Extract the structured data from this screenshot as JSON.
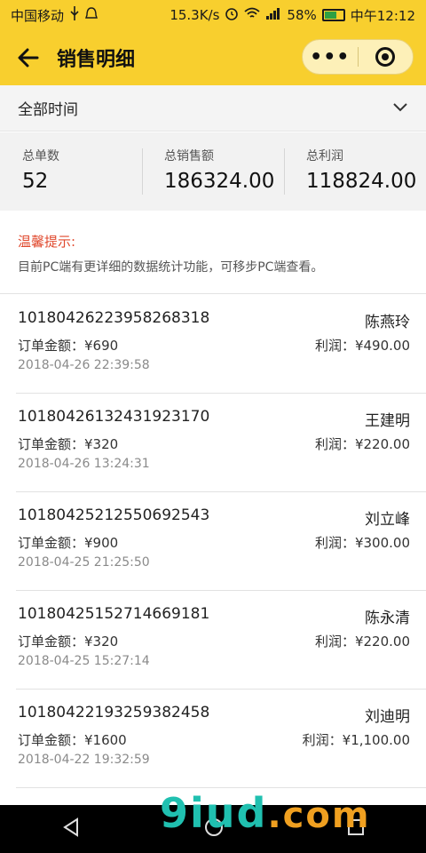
{
  "status_bar": {
    "carrier": "中国移动",
    "speed": "15.3K/s",
    "battery": "58%",
    "time": "中午12:12"
  },
  "header": {
    "title": "销售明细",
    "more_label": "•••"
  },
  "filter": {
    "selected": "全部时间"
  },
  "stats": {
    "orders_label": "总单数",
    "orders_value": "52",
    "sales_label": "总销售额",
    "sales_value": "186324.00",
    "profit_label": "总利润",
    "profit_value": "118824.00"
  },
  "notice": {
    "title": "温馨提示:",
    "text": "目前PC端有更详细的数据统计功能，可移步PC端查看。"
  },
  "orders": [
    {
      "no": "10180426223958268318",
      "name": "陈燕玲",
      "amount": "订单金额：¥690",
      "profit": "利润：¥490.00",
      "time": "2018-04-26 22:39:58"
    },
    {
      "no": "10180426132431923170",
      "name": "王建明",
      "amount": "订单金额：¥320",
      "profit": "利润：¥220.00",
      "time": "2018-04-26 13:24:31"
    },
    {
      "no": "10180425212550692543",
      "name": "刘立峰",
      "amount": "订单金额：¥900",
      "profit": "利润：¥300.00",
      "time": "2018-04-25 21:25:50"
    },
    {
      "no": "10180425152714669181",
      "name": "陈永清",
      "amount": "订单金额：¥320",
      "profit": "利润：¥220.00",
      "time": "2018-04-25 15:27:14"
    },
    {
      "no": "10180422193259382458",
      "name": "刘迪明",
      "amount": "订单金额：¥1600",
      "profit": "利润：¥1,100.00",
      "time": "2018-04-22 19:32:59"
    }
  ],
  "watermark": {
    "brand": "9iud",
    "domain": ".com"
  },
  "colors": {
    "header_bg": "#f8cf2e",
    "notice_title": "#e0492e"
  }
}
